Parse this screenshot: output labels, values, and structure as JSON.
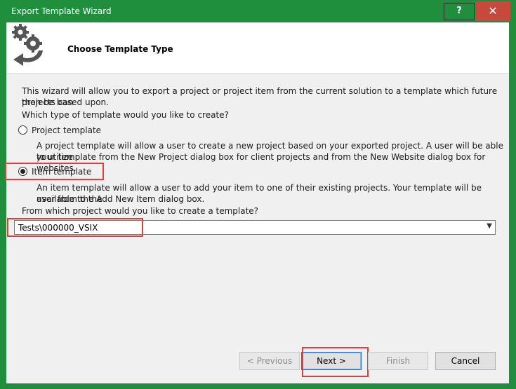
{
  "window": {
    "title": "Export Template Wizard",
    "help_label": "?",
    "close_label": "✕"
  },
  "header": {
    "title": "Choose Template Type"
  },
  "intro": {
    "line1": "This wizard will allow you to export a project or project item from the current solution to a template which future projects can",
    "line2": "then be based upon.",
    "question": "Which type of template would you like to create?"
  },
  "options": {
    "project": {
      "label": "Project template",
      "desc1": "A project template will allow a user to create a new project based on your exported project. A user will be able to utilize",
      "desc2": "your template from the New Project dialog box for client projects and from the New Website dialog box for websites.",
      "selected": false
    },
    "item": {
      "label": "Item template",
      "desc1": "An item template will allow a user to add your item to one of their existing projects. Your template will be available to the",
      "desc2": "user from the Add New Item dialog box.",
      "selected": true
    }
  },
  "project_select": {
    "prompt": "From which project would you like to create a template?",
    "value": "Tests\\000000_VSIX"
  },
  "buttons": {
    "previous": "< Previous",
    "next": "Next >",
    "finish": "Finish",
    "cancel": "Cancel"
  },
  "colors": {
    "titlebar": "#1f8f3e",
    "close": "#c7493e",
    "highlight": "#e0403a"
  }
}
